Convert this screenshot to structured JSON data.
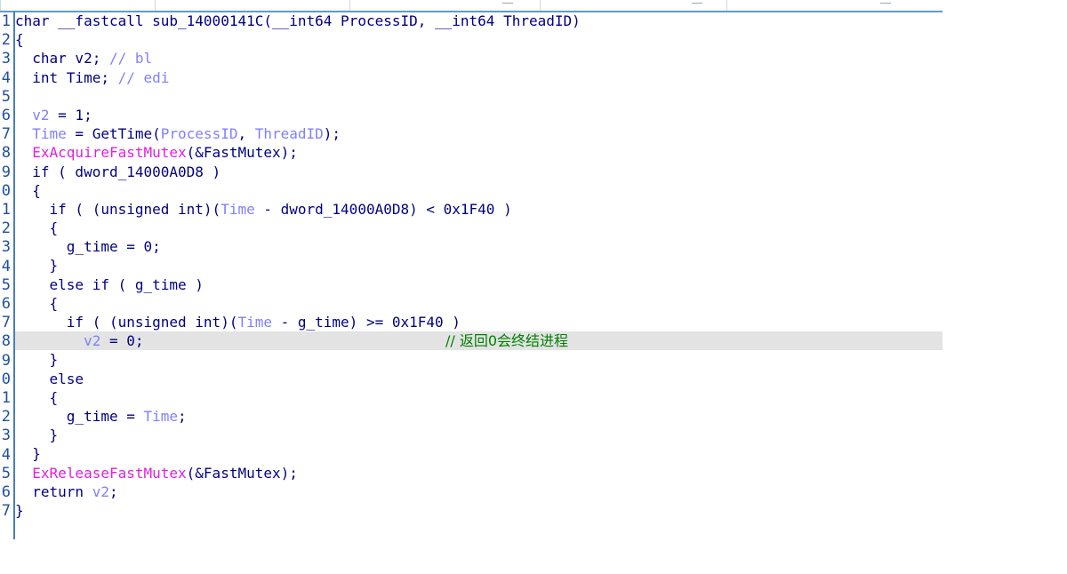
{
  "editor": {
    "line_numbers": [
      "1",
      "2",
      "3",
      "4",
      "5",
      "6",
      "7",
      "8",
      "9",
      "0",
      "1",
      "2",
      "3",
      "4",
      "5",
      "6",
      "7",
      "8",
      "9",
      "0",
      "1",
      "2",
      "3",
      "4",
      "5",
      "6",
      "7"
    ],
    "lines": [
      {
        "indent": "",
        "tokens": [
          {
            "t": "char __fastcall sub_14000141C(__int64 ProcessID, __int64 ThreadID)",
            "c": "kw"
          }
        ]
      },
      {
        "indent": "",
        "tokens": [
          {
            "t": "{",
            "c": "kw"
          }
        ]
      },
      {
        "indent": "  ",
        "tokens": [
          {
            "t": "char v2; ",
            "c": "kw"
          },
          {
            "t": "// bl",
            "c": "var"
          }
        ]
      },
      {
        "indent": "  ",
        "tokens": [
          {
            "t": "int Time; ",
            "c": "kw"
          },
          {
            "t": "// edi",
            "c": "var"
          }
        ]
      },
      {
        "indent": "",
        "tokens": []
      },
      {
        "indent": "  ",
        "tokens": [
          {
            "t": "v2",
            "c": "var"
          },
          {
            "t": " = 1;",
            "c": "kw"
          }
        ]
      },
      {
        "indent": "  ",
        "tokens": [
          {
            "t": "Time",
            "c": "var"
          },
          {
            "t": " = GetTime(",
            "c": "kw"
          },
          {
            "t": "ProcessID",
            "c": "var"
          },
          {
            "t": ", ",
            "c": "kw"
          },
          {
            "t": "ThreadID",
            "c": "var"
          },
          {
            "t": ");",
            "c": "kw"
          }
        ]
      },
      {
        "indent": "  ",
        "tokens": [
          {
            "t": "ExAcquireFastMutex",
            "c": "fn"
          },
          {
            "t": "(&FastMutex);",
            "c": "kw"
          }
        ]
      },
      {
        "indent": "  ",
        "tokens": [
          {
            "t": "if ( dword_14000A0D8 )",
            "c": "kw"
          }
        ]
      },
      {
        "indent": "  ",
        "tokens": [
          {
            "t": "{",
            "c": "kw"
          }
        ]
      },
      {
        "indent": "    ",
        "tokens": [
          {
            "t": "if ( (unsigned int)(",
            "c": "kw"
          },
          {
            "t": "Time",
            "c": "var"
          },
          {
            "t": " - dword_14000A0D8) < 0x1F40 )",
            "c": "kw"
          }
        ]
      },
      {
        "indent": "    ",
        "tokens": [
          {
            "t": "{",
            "c": "kw"
          }
        ]
      },
      {
        "indent": "      ",
        "tokens": [
          {
            "t": "g_time = 0;",
            "c": "kw"
          }
        ]
      },
      {
        "indent": "    ",
        "tokens": [
          {
            "t": "}",
            "c": "kw"
          }
        ]
      },
      {
        "indent": "    ",
        "tokens": [
          {
            "t": "else if ( g_time )",
            "c": "kw"
          }
        ]
      },
      {
        "indent": "    ",
        "tokens": [
          {
            "t": "{",
            "c": "kw"
          }
        ]
      },
      {
        "indent": "      ",
        "tokens": [
          {
            "t": "if ( (unsigned int)(",
            "c": "kw"
          },
          {
            "t": "Time",
            "c": "var"
          },
          {
            "t": " - g_time) >= 0x1F40 )",
            "c": "kw"
          }
        ]
      },
      {
        "indent": "        ",
        "highlight": true,
        "tokens": [
          {
            "t": "v2",
            "c": "var"
          },
          {
            "t": " = 0;",
            "c": "kw"
          }
        ],
        "comment": "// 返回0会终结进程"
      },
      {
        "indent": "    ",
        "tokens": [
          {
            "t": "}",
            "c": "kw"
          }
        ]
      },
      {
        "indent": "    ",
        "tokens": [
          {
            "t": "else",
            "c": "kw"
          }
        ]
      },
      {
        "indent": "    ",
        "tokens": [
          {
            "t": "{",
            "c": "kw"
          }
        ]
      },
      {
        "indent": "      ",
        "tokens": [
          {
            "t": "g_time = ",
            "c": "kw"
          },
          {
            "t": "Time",
            "c": "var"
          },
          {
            "t": ";",
            "c": "kw"
          }
        ]
      },
      {
        "indent": "    ",
        "tokens": [
          {
            "t": "}",
            "c": "kw"
          }
        ]
      },
      {
        "indent": "  ",
        "tokens": [
          {
            "t": "}",
            "c": "kw"
          }
        ]
      },
      {
        "indent": "  ",
        "tokens": [
          {
            "t": "ExReleaseFastMutex",
            "c": "fn"
          },
          {
            "t": "(&FastMutex);",
            "c": "kw"
          }
        ]
      },
      {
        "indent": "  ",
        "tokens": [
          {
            "t": "return ",
            "c": "kw"
          },
          {
            "t": "v2",
            "c": "var"
          },
          {
            "t": ";",
            "c": "kw"
          }
        ]
      },
      {
        "indent": "",
        "tokens": [
          {
            "t": "}",
            "c": "kw"
          }
        ]
      }
    ]
  },
  "colors": {
    "keyword": "#000080",
    "variable": "#8080ff",
    "function": "#e020e0",
    "comment": "#008000",
    "highlight": "#e3e3e3"
  }
}
